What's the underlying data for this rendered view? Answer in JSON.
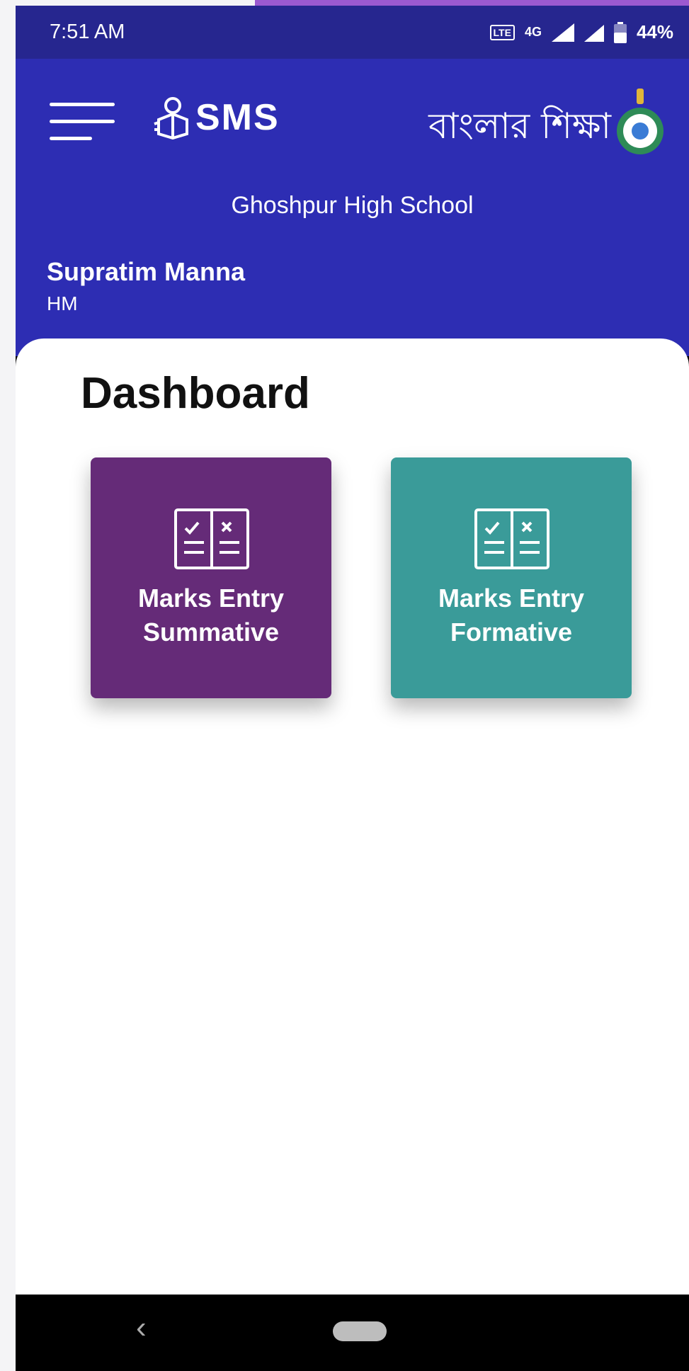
{
  "status": {
    "time": "7:51 AM",
    "network": "4G",
    "battery": "44%"
  },
  "header": {
    "app_name": "SMS",
    "brand_bangla": "বাংলার শিক্ষা",
    "school_name": "Ghoshpur High School",
    "user_name": "Supratim Manna",
    "user_role": "HM",
    "menu_icon": "hamburger-menu-icon",
    "emblem_icon": "govt-emblem-icon"
  },
  "dashboard": {
    "title": "Dashboard",
    "cards": [
      {
        "line1": "Marks Entry",
        "line2": "Summative",
        "color": "#652b78",
        "icon": "book-check-icon"
      },
      {
        "line1": "Marks Entry",
        "line2": "Formative",
        "color": "#3a9b99",
        "icon": "book-check-icon"
      }
    ]
  },
  "colors": {
    "statusbar": "#26268f",
    "appbar": "#2d2db3",
    "content_bg": "#ffffff"
  }
}
